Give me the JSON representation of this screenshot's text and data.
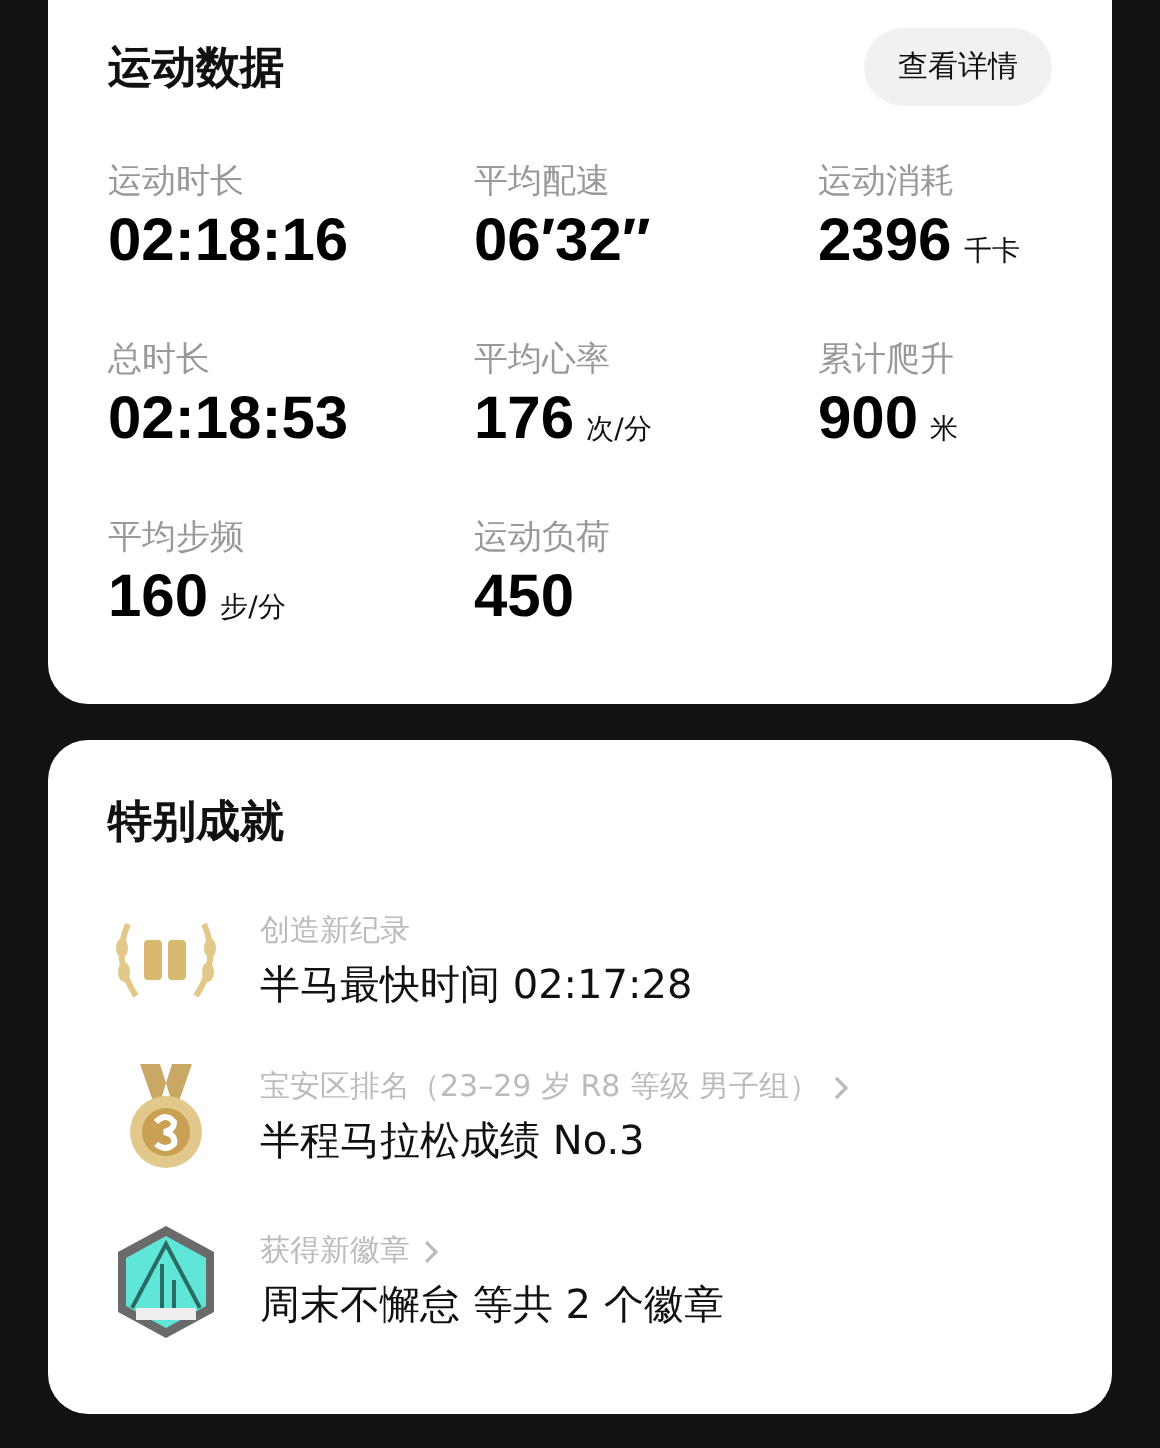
{
  "stats_card": {
    "title": "运动数据",
    "details_button": "查看详情",
    "metrics": [
      {
        "label": "运动时长",
        "value": "02:18:16"
      },
      {
        "label": "平均配速",
        "value": "06′32″"
      },
      {
        "label": "运动消耗",
        "value": "2396",
        "unit": "千卡"
      },
      {
        "label": "总时长",
        "value": "02:18:53"
      },
      {
        "label": "平均心率",
        "value": "176",
        "unit": "次/分"
      },
      {
        "label": "累计爬升",
        "value": "900",
        "unit": "米"
      },
      {
        "label": "平均步频",
        "value": "160",
        "unit": "步/分"
      },
      {
        "label": "运动负荷",
        "value": "450"
      }
    ]
  },
  "achievements_card": {
    "title": "特别成就",
    "items": [
      {
        "kind": "record",
        "caption": "创造新纪录",
        "text": "半马最快时间 02:17:28"
      },
      {
        "kind": "medal",
        "caption": "宝安区排名（23–29 岁 R8 等级 男子组）",
        "text": "半程马拉松成绩 No.3",
        "has_link": true
      },
      {
        "kind": "badge",
        "caption": "获得新徽章",
        "text": "周末不懈怠 等共 2 个徽章",
        "has_link": true
      }
    ]
  }
}
